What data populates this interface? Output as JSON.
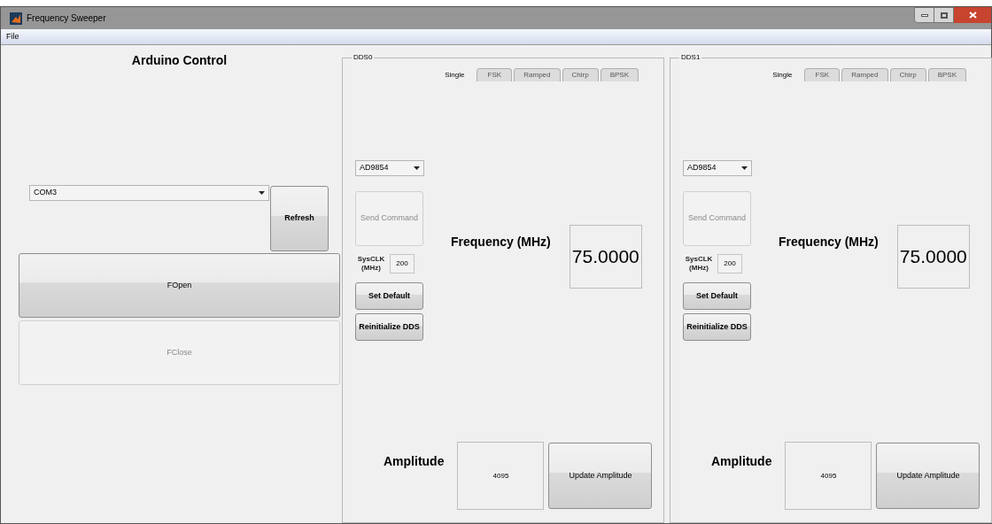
{
  "window": {
    "title": "Frequency Sweeper"
  },
  "menu": [
    "File"
  ],
  "arduino_control": {
    "title": "Arduino Control",
    "port": {
      "value": "COM3"
    },
    "refresh": {
      "label": "Refresh",
      "disabled": false
    },
    "open": {
      "label": "FOpen",
      "disabled": false
    },
    "close": {
      "label": "FClose",
      "disabled": true
    }
  },
  "dds_panels": [
    {
      "title": "DDS0",
      "tabs": [
        {
          "label": "Single",
          "selected": true
        },
        {
          "label": "FSK",
          "selected": false
        },
        {
          "label": "Ramped",
          "selected": false
        },
        {
          "label": "Chirp",
          "selected": false
        },
        {
          "label": "BPSK",
          "selected": false
        }
      ],
      "chip": {
        "value": "AD9854"
      },
      "send_command": {
        "label": "Send Command",
        "disabled": true
      },
      "sysclk": {
        "label": "SysCLK (MHz)",
        "value": "200"
      },
      "set_default": {
        "label": "Set Default",
        "disabled": false
      },
      "reinitialize": {
        "label": "Reinitialize DDS",
        "disabled": false
      },
      "frequency": {
        "label": "Frequency (MHz)",
        "value": "75.0000"
      },
      "amplitude": {
        "label": "Amplitude",
        "value": "4095"
      },
      "update_amplitude": {
        "label": "Update Amplitude",
        "disabled": false
      }
    },
    {
      "title": "DDS1",
      "tabs": [
        {
          "label": "Single",
          "selected": true
        },
        {
          "label": "FSK",
          "selected": false
        },
        {
          "label": "Ramped",
          "selected": false
        },
        {
          "label": "Chirp",
          "selected": false
        },
        {
          "label": "BPSK",
          "selected": false
        }
      ],
      "chip": {
        "value": "AD9854"
      },
      "send_command": {
        "label": "Send Command",
        "disabled": true
      },
      "sysclk": {
        "label": "SysCLK (MHz)",
        "value": "200"
      },
      "set_default": {
        "label": "Set Default",
        "disabled": false
      },
      "reinitialize": {
        "label": "Reinitialize DDS",
        "disabled": false
      },
      "frequency": {
        "label": "Frequency (MHz)",
        "value": "75.0000"
      },
      "amplitude": {
        "label": "Amplitude",
        "value": "4095"
      },
      "update_amplitude": {
        "label": "Update Amplitude",
        "disabled": false
      }
    }
  ]
}
